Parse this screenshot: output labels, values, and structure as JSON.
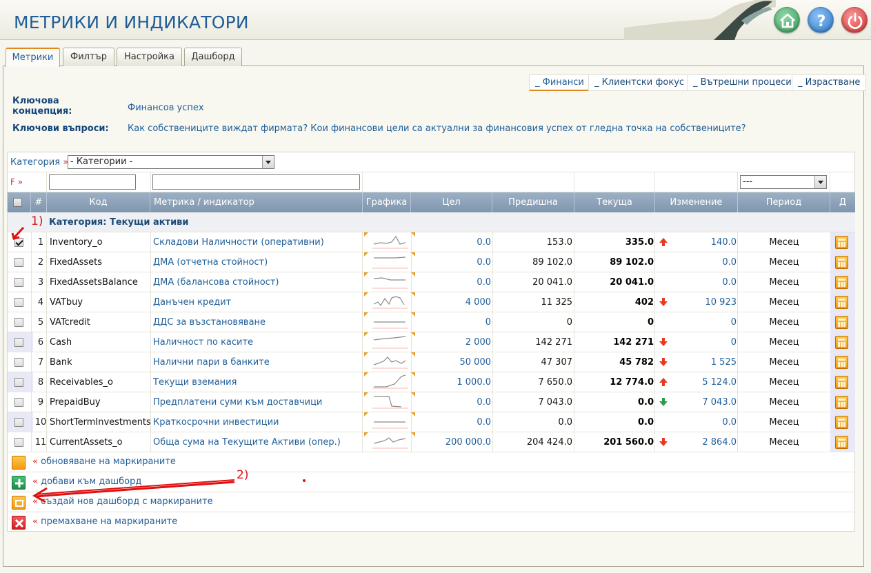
{
  "app": {
    "title": "МЕТРИКИ И ИНДИКАТОРИ"
  },
  "tabs": [
    {
      "label": "Метрики",
      "active": true
    },
    {
      "label": "Филтър",
      "active": false
    },
    {
      "label": "Настройка",
      "active": false
    },
    {
      "label": "Дашборд",
      "active": false
    }
  ],
  "subtabs": [
    {
      "label": "_ Финанси",
      "active": true
    },
    {
      "label": "_ Клиентски фокус",
      "active": false
    },
    {
      "label": "_ Вътрешни процеси",
      "active": false
    },
    {
      "label": "_ Израстване",
      "active": false
    }
  ],
  "concept": {
    "key_concept_label_1": "Ключова",
    "key_concept_label_2": "концепция:",
    "key_concept_value": "Финансов успех",
    "key_questions_label": "Ключови въпроси:",
    "key_questions_value": "Как собствениците виждат фирмата? Кои финансови цели са актуални за финансовия успех от гледна точка на собствениците?"
  },
  "filter": {
    "category_label": "Категория",
    "category_arrow": "»",
    "category_select": "- Категории -",
    "f_label": "F »",
    "code_value": "",
    "name_value": "",
    "period_select": "---"
  },
  "table": {
    "headers": {
      "num": "#",
      "code": "Код",
      "name": "Метрика / индикатор",
      "graph": "Графика",
      "target": "Цел",
      "previous": "Предишна",
      "current": "Текуща",
      "change": "Изменение",
      "period": "Период",
      "action": "Д"
    },
    "category_title": "Категория: Текущи активи",
    "rows": [
      {
        "num": "1",
        "code": "Inventory_o",
        "name": "Складови Наличности (оперативни)",
        "target": "0.0",
        "previous": "153.0",
        "current": "335.0",
        "trend": "up",
        "change": "140.0",
        "period": "Месец",
        "checked": true
      },
      {
        "num": "2",
        "code": "FixedAssets",
        "name": "ДМА (отчетна стойност)",
        "target": "0.0",
        "previous": "89 102.0",
        "current": "89 102.0",
        "trend": "none",
        "change": "0.0",
        "period": "Месец",
        "checked": false
      },
      {
        "num": "3",
        "code": "FixedAssetsBalance",
        "name": "ДМА (балансова стойност)",
        "target": "0.0",
        "previous": "20 041.0",
        "current": "20 041.0",
        "trend": "none",
        "change": "0.0",
        "period": "Месец",
        "checked": false
      },
      {
        "num": "4",
        "code": "VATbuy",
        "name": "Данъчен кредит",
        "target": "4 000",
        "previous": "11 325",
        "current": "402",
        "trend": "down",
        "change": "10 923",
        "period": "Месец",
        "checked": false
      },
      {
        "num": "5",
        "code": "VATcredit",
        "name": "ДДС за възстановяване",
        "target": "0",
        "previous": "0",
        "current": "0",
        "trend": "none",
        "change": "0",
        "period": "Месец",
        "checked": false
      },
      {
        "num": "6",
        "code": "Cash",
        "name": "Наличност по касите",
        "target": "2 000",
        "previous": "142 271",
        "current": "142 271",
        "trend": "down",
        "change": "0",
        "period": "Месец",
        "checked": false
      },
      {
        "num": "7",
        "code": "Bank",
        "name": "Налични пари в банките",
        "target": "50 000",
        "previous": "47 307",
        "current": "45 782",
        "trend": "down",
        "change": "1 525",
        "period": "Месец",
        "checked": false
      },
      {
        "num": "8",
        "code": "Receivables_o",
        "name": "Текущи вземания",
        "target": "1 000.0",
        "previous": "7 650.0",
        "current": "12 774.0",
        "trend": "up",
        "change": "5 124.0",
        "period": "Месец",
        "checked": false
      },
      {
        "num": "9",
        "code": "PrepaidBuy",
        "name": "Предплатени суми към доставчици",
        "target": "0.0",
        "previous": "7 043.0",
        "current": "0.0",
        "trend": "down-green",
        "change": "7 043.0",
        "period": "Месец",
        "checked": false
      },
      {
        "num": "10",
        "code": "ShortTermInvestments",
        "name": "Краткосрочни инвестиции",
        "target": "0.0",
        "previous": "0.0",
        "current": "0.0",
        "trend": "none",
        "change": "0.0",
        "period": "Месец",
        "checked": false
      },
      {
        "num": "11",
        "code": "CurrentAssets_o",
        "name": "Обща сума на Текущите Активи (опер.)",
        "target": "200 000.0",
        "previous": "204 424.0",
        "current": "201 560.0",
        "trend": "down",
        "change": "2 864.0",
        "period": "Месец",
        "checked": false
      }
    ]
  },
  "actions": [
    {
      "prefix": "«",
      "label": "обновяване на маркираните",
      "icon": "calculator-icon"
    },
    {
      "prefix": "«",
      "label": "добави към дашборд",
      "icon": "add-icon"
    },
    {
      "prefix": "«",
      "label": "създай нов дашборд с маркираните",
      "icon": "dashboard-icon"
    },
    {
      "prefix": "«",
      "label": "премахване на маркираните",
      "icon": "delete-icon"
    }
  ],
  "annotations": {
    "one": "1)",
    "two": "2)"
  },
  "colors": {
    "accent": "#1f5e98",
    "header_bg": "#8ca2b9",
    "up": "#e8381e",
    "down": "#e8381e",
    "down_green": "#2f9a4a",
    "highlight": "#e08a1e"
  }
}
